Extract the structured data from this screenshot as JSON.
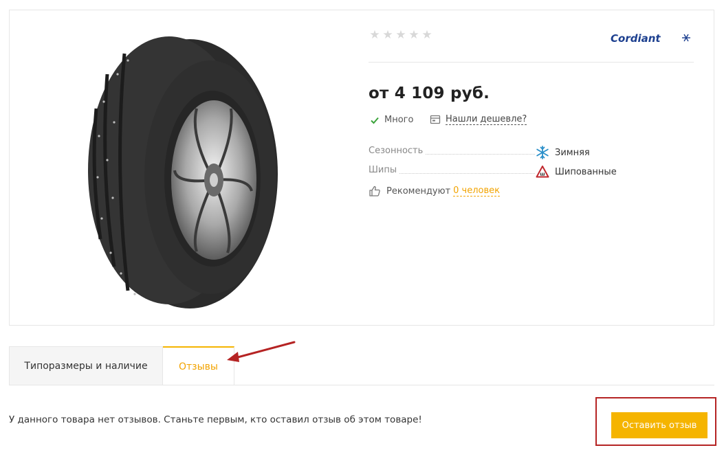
{
  "product": {
    "rating_stars": 5,
    "rating_value": 0,
    "brand": "Cordiant",
    "price": "от 4 109 руб.",
    "stock_label": "Много",
    "cheaper_label": "Нашли дешевле?",
    "specs": [
      {
        "label": "Сезонность",
        "value": "Зимняя",
        "icon": "snowflake-icon"
      },
      {
        "label": "Шипы",
        "value": "Шипованные",
        "icon": "spikes-warning-icon"
      }
    ],
    "recommend": {
      "label": "Рекомендуют",
      "link": "0 человек"
    }
  },
  "tabs": [
    {
      "label": "Типоразмеры и наличие",
      "active": false
    },
    {
      "label": "Отзывы",
      "active": true
    }
  ],
  "reviews": {
    "empty_message": "У данного товара нет отзывов. Станьте первым, кто оставил отзыв об этом товаре!",
    "button_label": "Оставить отзыв"
  },
  "colors": {
    "accent": "#f5b400",
    "link": "#f2a300",
    "brand_blue": "#1c3f8f",
    "highlight_red": "#b52323",
    "check_green": "#3aa33a",
    "snow_blue": "#2a8fc9"
  }
}
